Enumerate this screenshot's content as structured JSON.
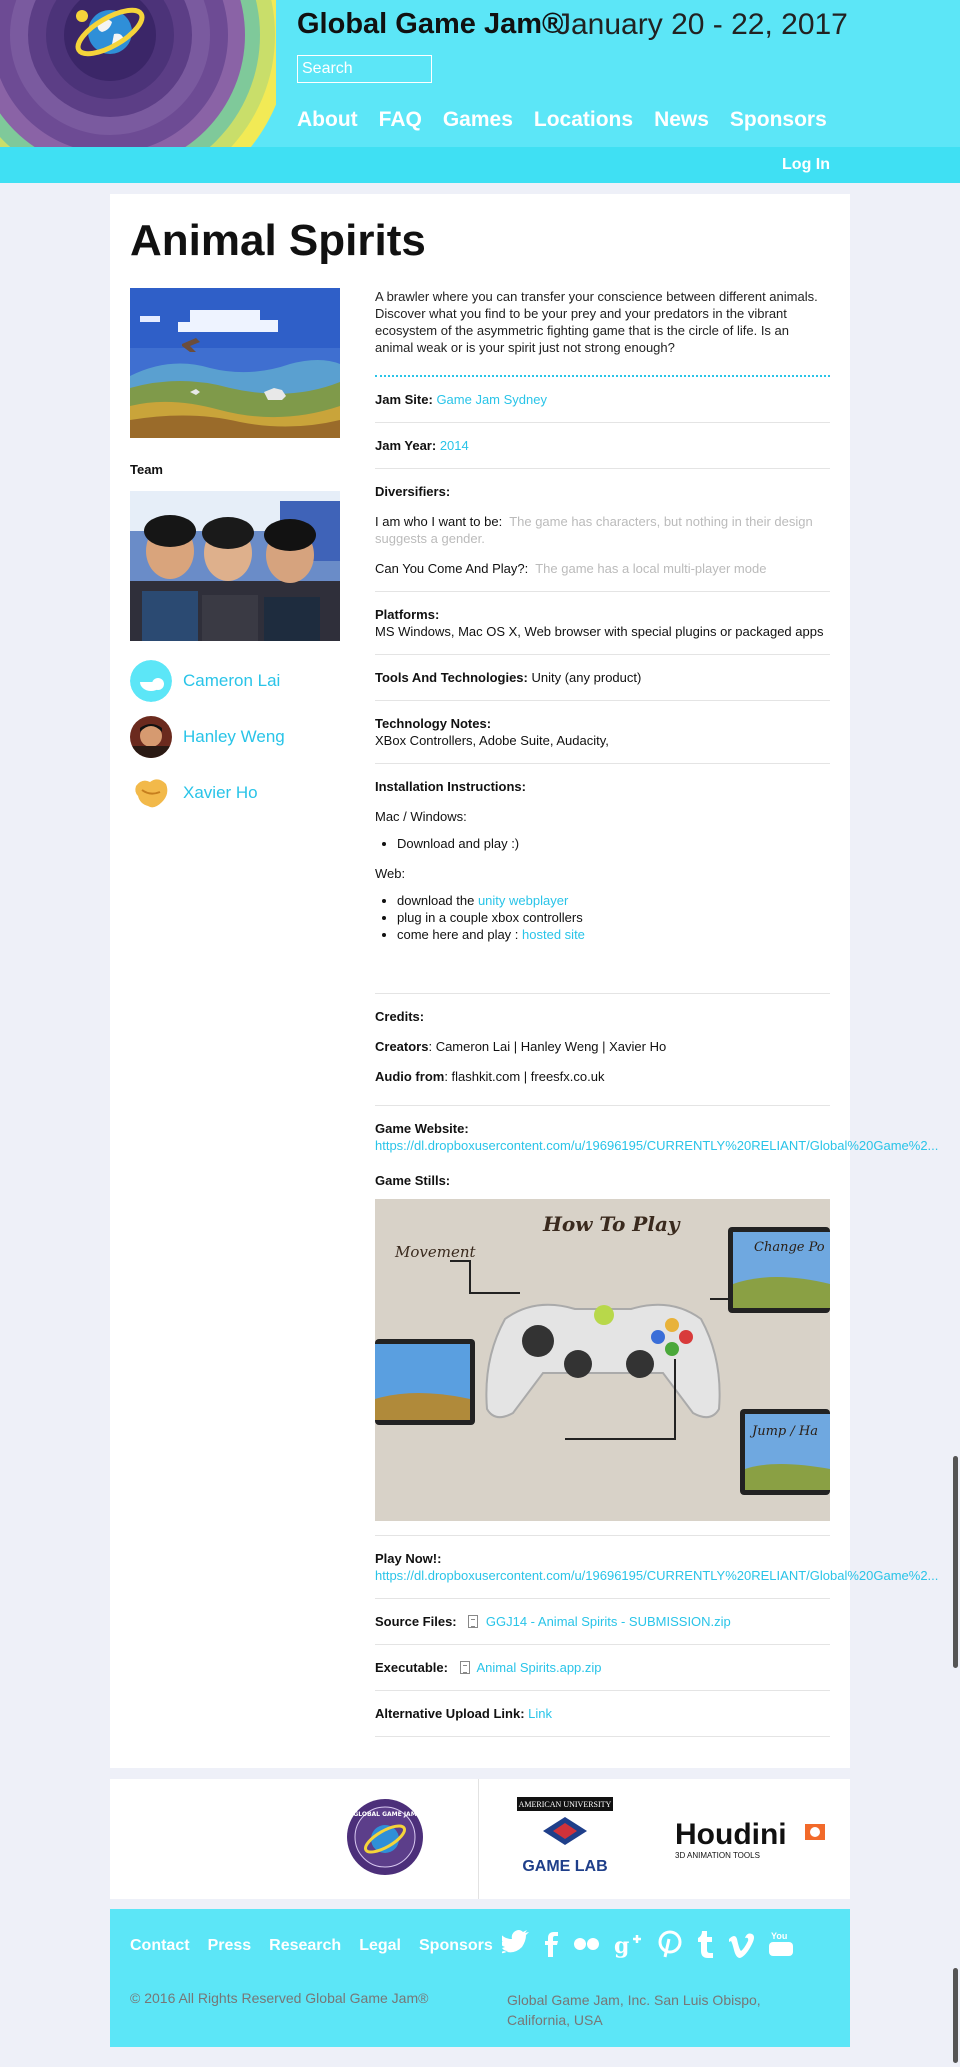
{
  "header": {
    "site_title": "Global Game Jam®",
    "date": "January 20 - 22, 2017",
    "search_placeholder": "Search",
    "nav": [
      "About",
      "FAQ",
      "Games",
      "Locations",
      "News",
      "Sponsors"
    ],
    "login": "Log In"
  },
  "game": {
    "title": "Animal Spirits",
    "description": "A brawler where you can transfer your conscience between different animals. Discover what you find to be your prey and your predators in the vibrant ecosystem of the asymmetric fighting game that is the circle of life. Is an animal weak or is your spirit just not strong enough?",
    "team_heading": "Team",
    "team": [
      {
        "name": "Cameron Lai"
      },
      {
        "name": "Hanley Weng"
      },
      {
        "name": "Xavier Ho"
      }
    ],
    "jam_site_label": "Jam Site:",
    "jam_site": "Game Jam Sydney",
    "jam_year_label": "Jam Year:",
    "jam_year": "2014",
    "diversifiers_label": "Diversifiers:",
    "div1_label": "I am who I want to be:",
    "div1_value": "The game has characters, but nothing in their design suggests a gender.",
    "div2_label": "Can You Come And Play?:",
    "div2_value": "The game has a local multi-player mode",
    "platforms_label": "Platforms:",
    "platforms": "MS Windows, Mac OS X, Web browser with special plugins or packaged apps",
    "tools_label": "Tools And Technologies:",
    "tools": "Unity (any product)",
    "tech_notes_label": "Technology Notes:",
    "tech_notes": "XBox Controllers, Adobe Suite, Audacity,",
    "install_label": "Installation Instructions:",
    "install_mac": "Mac / Windows:",
    "install_mac_item": "Download and play :)",
    "install_web": "Web:",
    "install_web_item1_prefix": "download the ",
    "install_web_item1_link": "unity webplayer",
    "install_web_item2": "plug in a couple xbox controllers",
    "install_web_item3_prefix": "come here and play : ",
    "install_web_item3_link": "hosted site",
    "credits_label": "Credits:",
    "creators_label": "Creators",
    "creators": ": Cameron Lai | Hanley Weng | Xavier Ho",
    "audio_label": "Audio from",
    "audio": ": flashkit.com | freesfx.co.uk",
    "website_label": "Game Website:",
    "website": "https://dl.dropboxusercontent.com/u/19696195/CURRENTLY%20RELIANT/Global%20Game%2...",
    "stills_label": "Game Stills:",
    "still_heading": "How To Play",
    "still_movement": "Movement",
    "still_change": "Change Po",
    "still_jump": "Jump / Ha",
    "play_label": "Play Now!:",
    "play_url": "https://dl.dropboxusercontent.com/u/19696195/CURRENTLY%20RELIANT/Global%20Game%2...",
    "source_label": "Source Files:",
    "source_file": "GGJ14 - Animal Spirits - SUBMISSION.zip",
    "exec_label": "Executable:",
    "exec_file": "Animal Spirits.app.zip",
    "alt_label": "Alternative Upload Link:",
    "alt_link": "Link"
  },
  "sponsors": {
    "ggj_seal_text": "GLOBAL GAME JAM",
    "american_university": "AMERICAN UNIVERSITY",
    "game_lab": "GAME LAB",
    "houdini": "Houdini",
    "houdini_sub": "3D ANIMATION TOOLS"
  },
  "footer": {
    "links": [
      "Contact",
      "Press",
      "Research",
      "Legal",
      "Sponsors"
    ],
    "social_icons": [
      "twitter-icon",
      "facebook-icon",
      "flickr-icon",
      "google-plus-icon",
      "pinterest-icon",
      "tumblr-icon",
      "vimeo-icon",
      "youtube-icon"
    ],
    "copyright": "© 2016 All Rights Reserved  Global Game Jam®",
    "address": "Global Game Jam, Inc. San Luis Obispo, California, USA"
  },
  "colors": {
    "header_bg": "#5ce6f7",
    "subbar_bg": "#3fe0f3",
    "link": "#29c4e8",
    "page_bg": "#eef0f8"
  }
}
